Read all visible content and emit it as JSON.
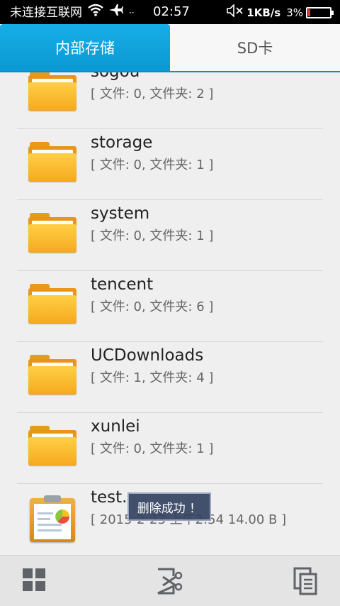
{
  "status_bar": {
    "carrier": "未连接互联网",
    "time": "02:57",
    "net_speed": "1KB/s",
    "battery": "3%",
    "battery_level": 0.03,
    "icons": [
      "wifi-icon",
      "airplane-icon",
      "mute-icon",
      "battery-icon"
    ]
  },
  "tabs": [
    {
      "label": "内部存储",
      "active": true
    },
    {
      "label": "SD卡",
      "active": false
    }
  ],
  "files": [
    {
      "name": "sogou",
      "meta": "[ 文件: 0, 文件夹: 2 ]",
      "icon": "folder-icon"
    },
    {
      "name": "storage",
      "meta": "[ 文件: 0, 文件夹: 1 ]",
      "icon": "folder-icon"
    },
    {
      "name": "system",
      "meta": "[ 文件: 0, 文件夹: 1 ]",
      "icon": "folder-icon"
    },
    {
      "name": "tencent",
      "meta": "[ 文件: 0, 文件夹: 6 ]",
      "icon": "folder-icon"
    },
    {
      "name": "UCDownloads",
      "meta": "[ 文件: 1, 文件夹: 4 ]",
      "icon": "folder-icon"
    },
    {
      "name": "xunlei",
      "meta": "[ 文件: 0, 文件夹: 1 ]",
      "icon": "folder-icon"
    },
    {
      "name": "test.",
      "meta": "[ 2015-2-23 上午2:54 14.00 B ]",
      "icon": "document-icon"
    }
  ],
  "toast": "删除成功 ！",
  "bottom_bar": [
    "grid-view-icon",
    "cut-icon",
    "copy-icon"
  ],
  "colors": {
    "accent": "#0b98d3",
    "folder": "#f6a91f"
  }
}
